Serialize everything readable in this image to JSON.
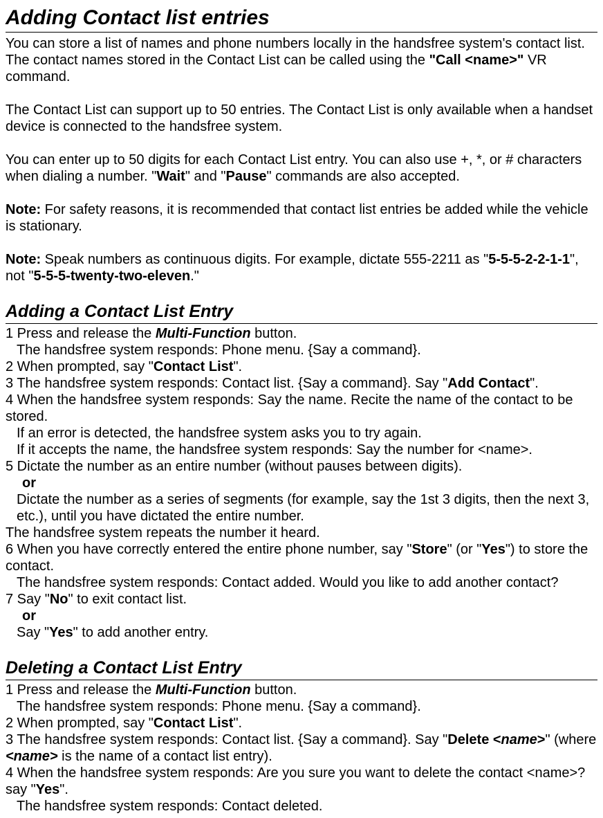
{
  "title": "Adding Contact list entries",
  "intro": [
    {
      "segments": [
        {
          "t": "You can store a list of names and phone numbers locally in the handsfree system's contact list. The contact names stored in the Contact List can be called using the "
        },
        {
          "t": "\"Call <name>\"",
          "cls": "b"
        },
        {
          "t": " VR command."
        }
      ]
    },
    {
      "segments": [
        {
          "t": "The Contact List can support up to 50 entries. The Contact List is only available when a handset device is connected to the handsfree system."
        }
      ]
    },
    {
      "segments": [
        {
          "t": "You can enter up to 50 digits for each Contact List entry. You can also use +, *, or # characters when dialing a number. \""
        },
        {
          "t": "Wait",
          "cls": "b"
        },
        {
          "t": "\" and \""
        },
        {
          "t": "Pause",
          "cls": "b"
        },
        {
          "t": "\" commands are also accepted."
        }
      ]
    },
    {
      "segments": [
        {
          "t": "Note:",
          "cls": "b"
        },
        {
          "t": " For safety reasons, it is recommended that contact list entries be added while the vehicle is stationary."
        }
      ]
    },
    {
      "segments": [
        {
          "t": "Note:",
          "cls": "b"
        },
        {
          "t": " Speak numbers as continuous digits. For example, dictate 555-2211 as \""
        },
        {
          "t": "5-5-5-2-2-1-1",
          "cls": "b"
        },
        {
          "t": "\", not \""
        },
        {
          "t": "5-5-5-twenty-two-eleven",
          "cls": "b"
        },
        {
          "t": ".\""
        }
      ]
    }
  ],
  "sections": [
    {
      "title": "Adding a Contact List Entry",
      "lines": [
        {
          "type": "step",
          "num": "1",
          "segments": [
            {
              "t": " Press and release the "
            },
            {
              "t": "Multi-Function",
              "cls": "bi"
            },
            {
              "t": " button."
            }
          ]
        },
        {
          "type": "indent",
          "segments": [
            {
              "t": "The handsfree system responds: Phone menu. {Say a command}."
            }
          ]
        },
        {
          "type": "step",
          "num": "2",
          "segments": [
            {
              "t": " When prompted, say \""
            },
            {
              "t": "Contact List",
              "cls": "b"
            },
            {
              "t": "\"."
            }
          ]
        },
        {
          "type": "step",
          "num": "3",
          "segments": [
            {
              "t": " The handsfree system responds: Contact list. {Say a command}. Say \""
            },
            {
              "t": "Add Contact",
              "cls": "b"
            },
            {
              "t": "\"."
            }
          ]
        },
        {
          "type": "step",
          "num": "4",
          "segments": [
            {
              "t": " When the handsfree system responds: Say the name. Recite the name of the contact to be stored."
            }
          ]
        },
        {
          "type": "indent",
          "segments": [
            {
              "t": "If an error is detected, the handsfree system asks you to try again."
            }
          ]
        },
        {
          "type": "indent",
          "segments": [
            {
              "t": "If it accepts the name, the handsfree system responds: Say the number for <name>."
            }
          ]
        },
        {
          "type": "step",
          "num": "5",
          "segments": [
            {
              "t": " Dictate the number as an entire number (without pauses between digits)."
            }
          ]
        },
        {
          "type": "or",
          "segments": [
            {
              "t": "or"
            }
          ]
        },
        {
          "type": "indent",
          "segments": [
            {
              "t": "Dictate the number as a series of segments (for example, say the 1st 3 digits, then the next 3,  etc.), until you have dictated the entire number."
            }
          ]
        },
        {
          "type": "plain",
          "segments": [
            {
              "t": "The handsfree system repeats the number it heard."
            }
          ]
        },
        {
          "type": "step",
          "num": "6",
          "segments": [
            {
              "t": " When you have correctly entered the entire phone number, say \""
            },
            {
              "t": "Store",
              "cls": "b"
            },
            {
              "t": "\" (or \""
            },
            {
              "t": "Yes",
              "cls": "b"
            },
            {
              "t": "\") to store the contact."
            }
          ]
        },
        {
          "type": "indent",
          "segments": [
            {
              "t": "The handsfree system responds: Contact added. Would you like to add another contact?"
            }
          ]
        },
        {
          "type": "step",
          "num": "7",
          "segments": [
            {
              "t": " Say \""
            },
            {
              "t": "No",
              "cls": "b"
            },
            {
              "t": "\" to exit contact list."
            }
          ]
        },
        {
          "type": "or",
          "segments": [
            {
              "t": "or"
            }
          ]
        },
        {
          "type": "indent",
          "segments": [
            {
              "t": "Say \""
            },
            {
              "t": "Yes",
              "cls": "b"
            },
            {
              "t": "\" to add another entry."
            }
          ]
        }
      ]
    },
    {
      "title": "Deleting a Contact List Entry",
      "lines": [
        {
          "type": "step",
          "num": "1",
          "segments": [
            {
              "t": " Press and release the "
            },
            {
              "t": "Multi-Function",
              "cls": "bi"
            },
            {
              "t": " button."
            }
          ]
        },
        {
          "type": "indent",
          "segments": [
            {
              "t": "The handsfree system responds: Phone menu. {Say a command}."
            }
          ]
        },
        {
          "type": "step",
          "num": "2",
          "segments": [
            {
              "t": " When prompted, say \""
            },
            {
              "t": "Contact List",
              "cls": "b"
            },
            {
              "t": "\"."
            }
          ]
        },
        {
          "type": "step",
          "num": "3",
          "segments": [
            {
              "t": " The handsfree system responds: Contact list. {Say a command}. Say \""
            },
            {
              "t": "Delete <",
              "cls": "b"
            },
            {
              "t": "name",
              "cls": "bi"
            },
            {
              "t": ">",
              "cls": "b"
            },
            {
              "t": "\" (where "
            },
            {
              "t": "<name>",
              "cls": "bi"
            },
            {
              "t": " is the name of a contact list entry)."
            }
          ]
        },
        {
          "type": "step",
          "num": "4",
          "segments": [
            {
              "t": " When the handsfree system responds: Are you sure you want to delete the contact <name>? say \""
            },
            {
              "t": "Yes",
              "cls": "b"
            },
            {
              "t": "\"."
            }
          ]
        },
        {
          "type": "indent",
          "segments": [
            {
              "t": "The handsfree system responds: Contact deleted."
            }
          ]
        }
      ]
    }
  ]
}
